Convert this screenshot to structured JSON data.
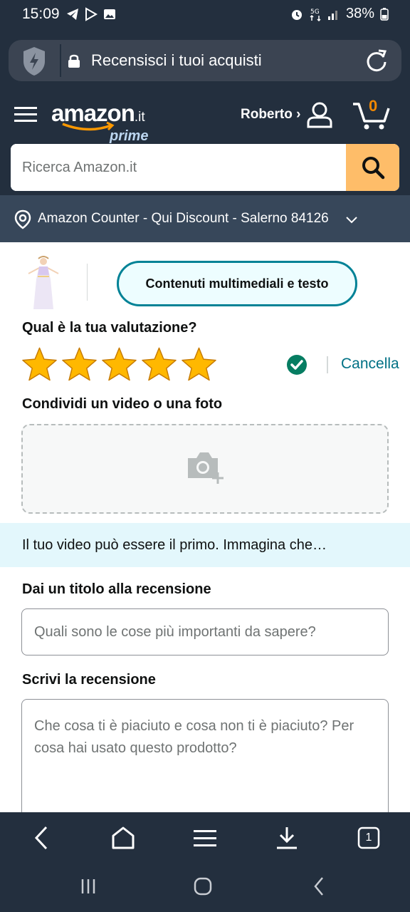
{
  "status_bar": {
    "time": "15:09",
    "battery": "38%",
    "icons": [
      "telegram-icon",
      "play-protect-icon",
      "gallery-icon",
      "alarm-icon",
      "5g-icon",
      "signal-icon",
      "battery-icon"
    ]
  },
  "browser": {
    "url_title": "Recensisci i tuoi acquisti",
    "tab_count": "1"
  },
  "header": {
    "logo_main": "amazon",
    "logo_suffix": ".it",
    "logo_prime": "prime",
    "account_label": "Roberto ›",
    "cart_count": "0",
    "search_placeholder": "Ricerca Amazon.it",
    "location": "Amazon Counter - Qui Discount - Salerno 84126"
  },
  "product": {
    "tab_label": "Contenuti multimediali e testo"
  },
  "review": {
    "rating_heading": "Qual è la tua valutazione?",
    "rating_value": 5,
    "rating_max": 5,
    "cancel_label": "Cancella",
    "share_heading": "Condividi un video o una foto",
    "promo_text": "Il tuo video può essere il primo. Immagina che…",
    "title_heading": "Dai un titolo alla recensione",
    "title_placeholder": "Quali sono le cose più importanti da sapere?",
    "review_heading": "Scrivi la recensione",
    "review_placeholder": "Che cosa ti è piaciuto e cosa non ti è piaciuto? Per cosa hai usato questo prodotto?"
  },
  "colors": {
    "header_bg": "#232f3e",
    "location_bg": "#37475a",
    "search_button": "#febd69",
    "star": "#ffa41c",
    "teal": "#008296",
    "link": "#007185",
    "check": "#067d62",
    "promo_bg": "#e3f7fc",
    "cart_count": "#f08804"
  }
}
